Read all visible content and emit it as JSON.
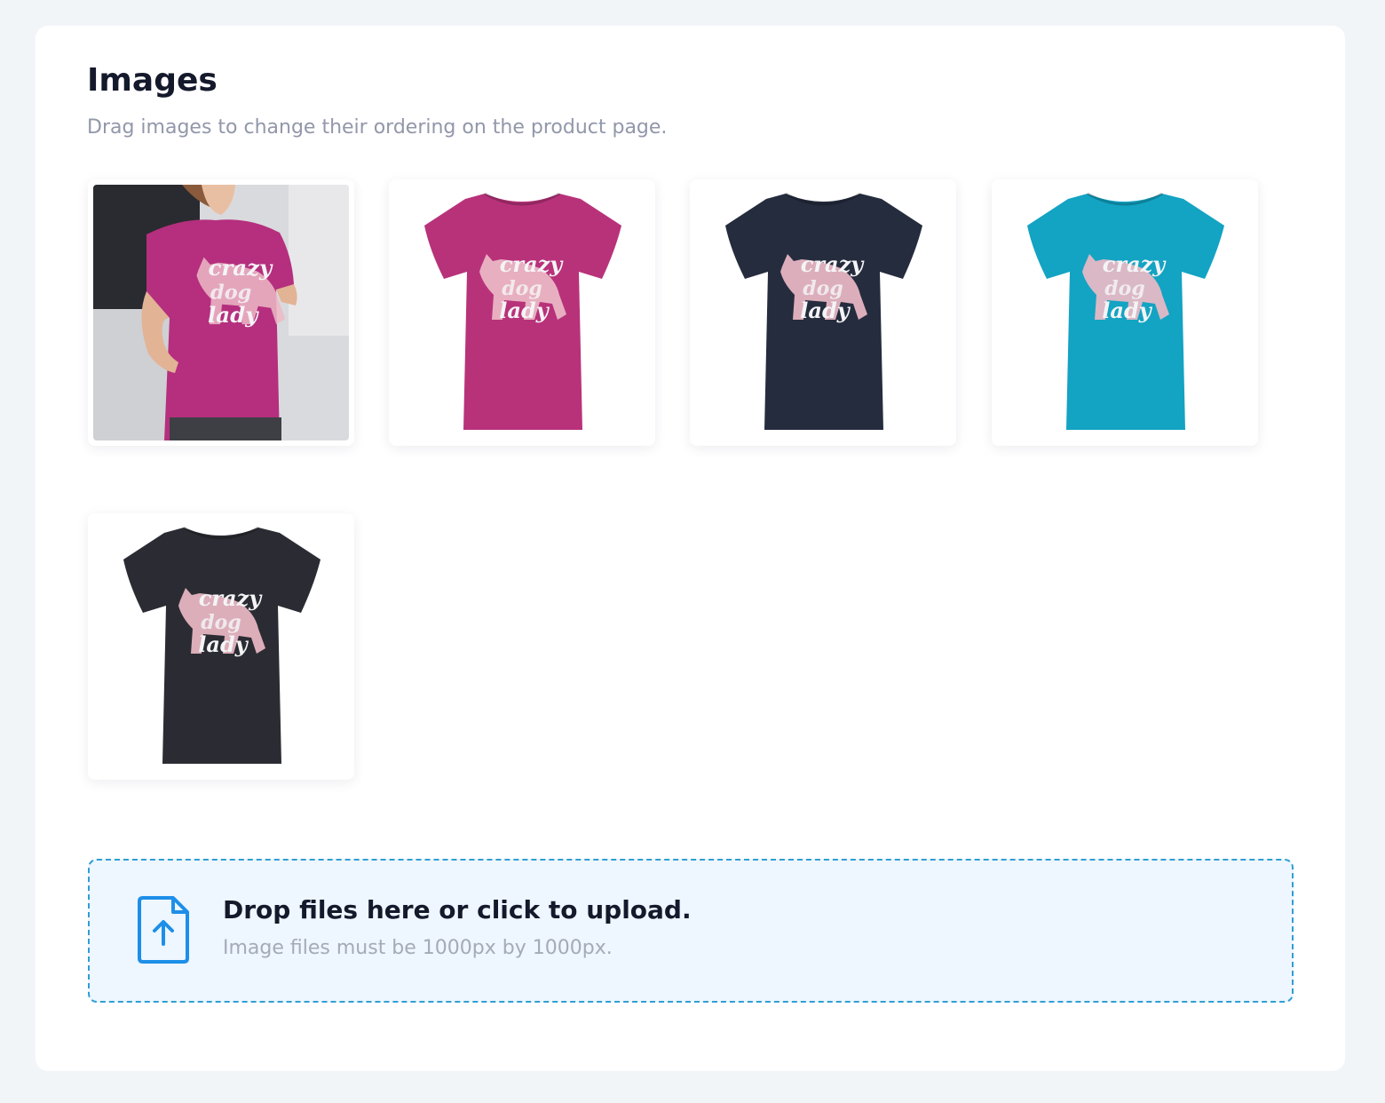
{
  "section": {
    "title": "Images",
    "subtitle": "Drag images to change their ordering on the product page."
  },
  "gallery": {
    "images": [
      {
        "kind": "lifestyle-photo",
        "shirt_color": "#b52f7e",
        "print": [
          "crazy",
          "dog",
          "lady"
        ]
      },
      {
        "kind": "flat-shirt",
        "shirt_color": "#b8327a",
        "print": [
          "crazy",
          "dog",
          "lady"
        ]
      },
      {
        "kind": "flat-shirt",
        "shirt_color": "#252c3e",
        "print": [
          "crazy",
          "dog",
          "lady"
        ]
      },
      {
        "kind": "flat-shirt",
        "shirt_color": "#13a3c3",
        "print": [
          "crazy",
          "dog",
          "lady"
        ]
      },
      {
        "kind": "flat-shirt",
        "shirt_color": "#2b2c33",
        "print": [
          "crazy",
          "dog",
          "lady"
        ]
      }
    ]
  },
  "upload": {
    "title": "Drop files here or click to upload.",
    "hint": "Image files must be 1000px by 1000px.",
    "icon": "file-upload-icon",
    "accent_color": "#1d8fe8",
    "border_color": "#2f9fd3",
    "background_color": "#eef6ff"
  }
}
